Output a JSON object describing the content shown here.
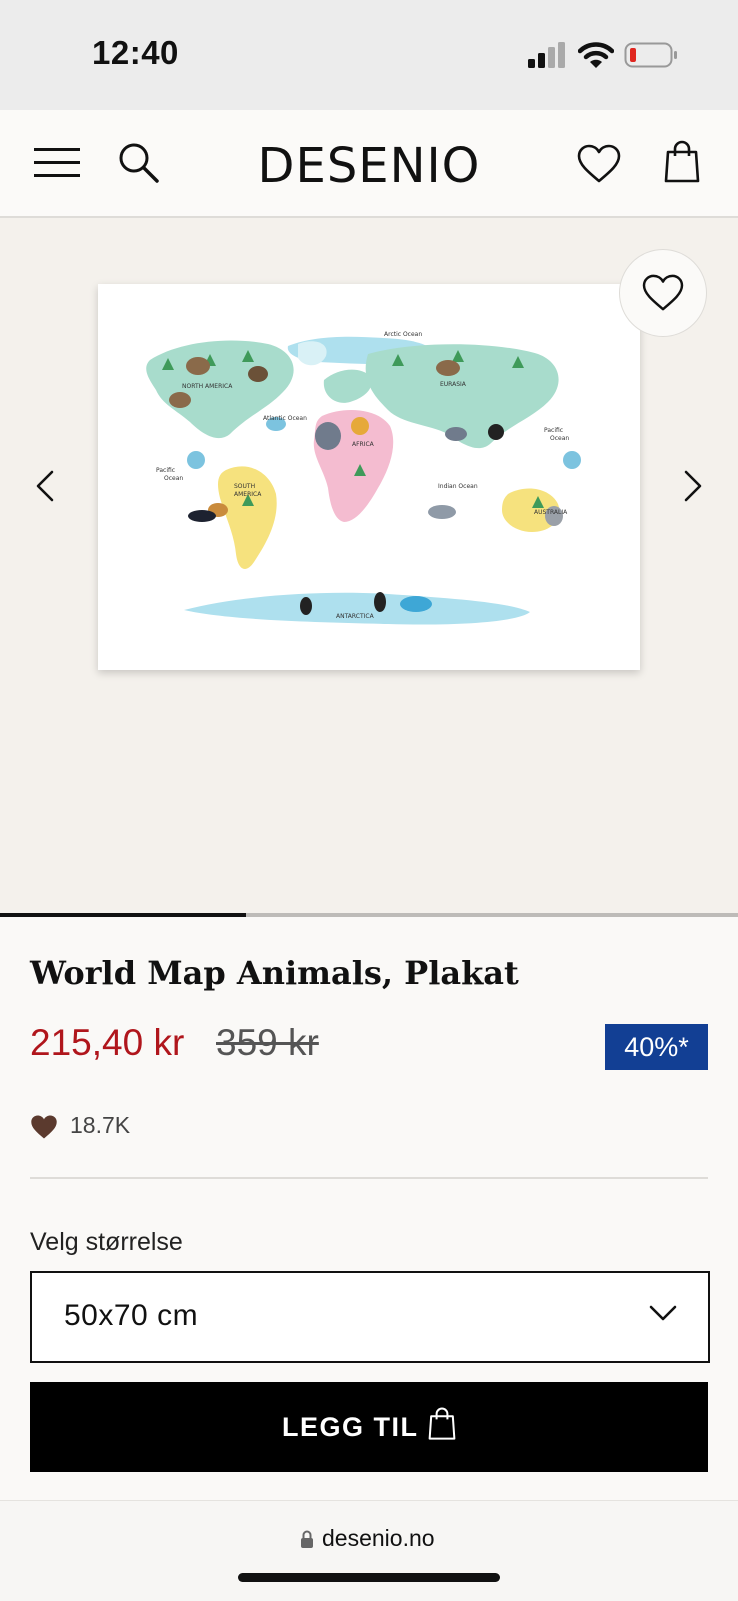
{
  "status": {
    "time": "12:40"
  },
  "header": {
    "logo": "DESENIO"
  },
  "gallery": {
    "slide_index": 1,
    "slide_count": 3
  },
  "product": {
    "title": "World Map Animals, Plakat",
    "price": "215,40 kr",
    "old_price": "359 kr",
    "discount": "40%*",
    "likes": "18.7K"
  },
  "size": {
    "label": "Velg størrelse",
    "value": "50x70 cm"
  },
  "cart": {
    "add_label": "LEGG TIL"
  },
  "browser": {
    "url": "desenio.no"
  },
  "colors": {
    "price_red": "#b0161c",
    "discount_blue": "#123f94",
    "like_heart": "#5b3a2e"
  }
}
